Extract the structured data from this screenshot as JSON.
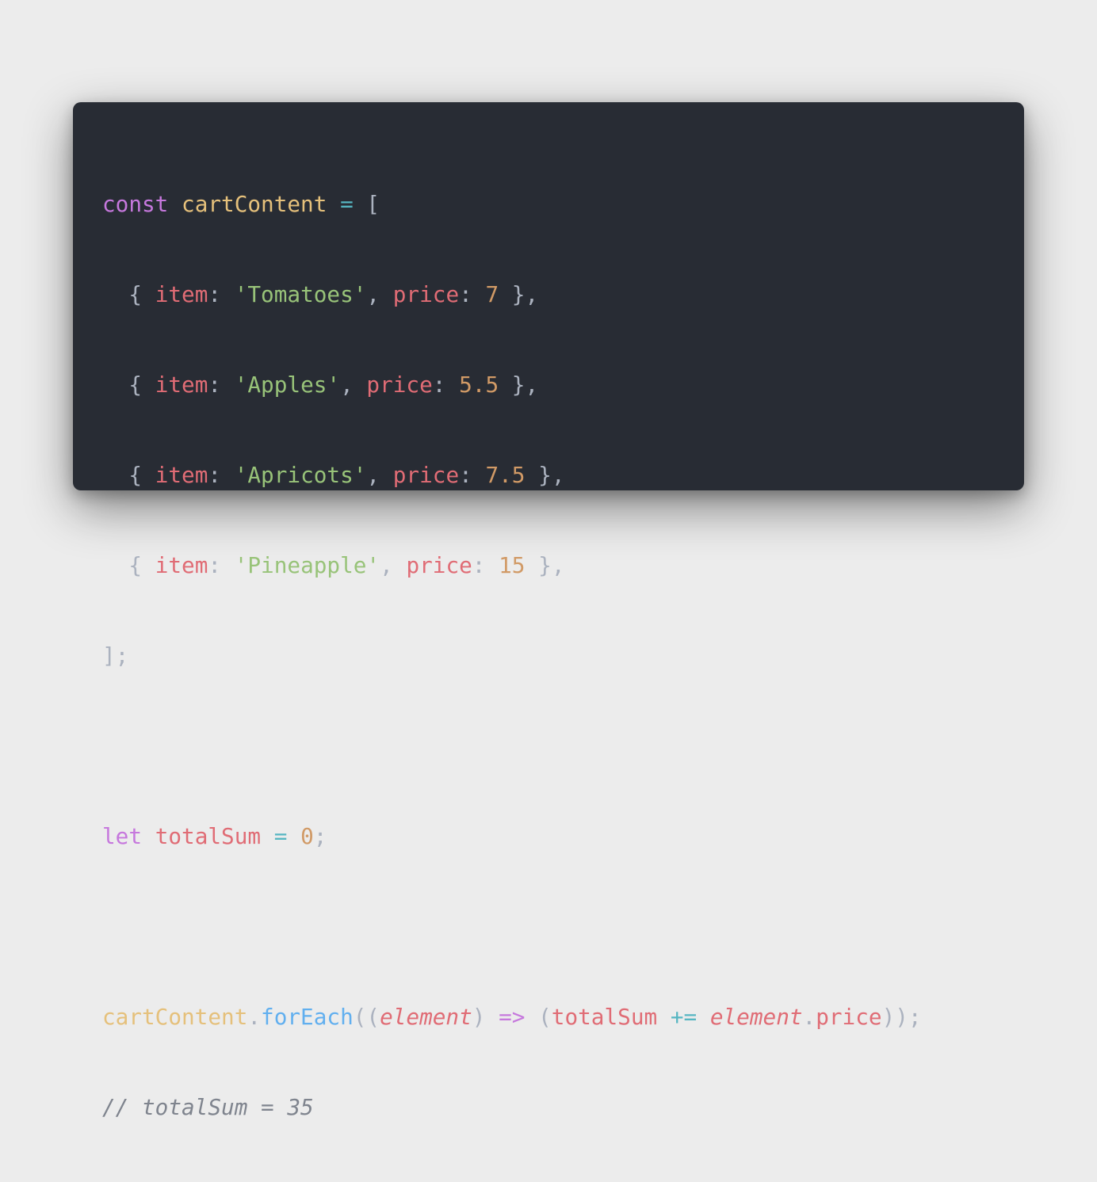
{
  "code": {
    "line1": {
      "kw": "const",
      "name": "cartContent",
      "op": "=",
      "open": "["
    },
    "items": [
      {
        "key1": "item",
        "str": "'Tomatoes'",
        "key2": "price",
        "num": "7"
      },
      {
        "key1": "item",
        "str": "'Apples'",
        "key2": "price",
        "num": "5.5"
      },
      {
        "key1": "item",
        "str": "'Apricots'",
        "key2": "price",
        "num": "7.5"
      },
      {
        "key1": "item",
        "str": "'Pineapple'",
        "key2": "price",
        "num": "15"
      }
    ],
    "close": "];",
    "line_let": {
      "kw": "let",
      "name": "totalSum",
      "op": "=",
      "num": "0",
      "end": ";"
    },
    "line_foreach": {
      "obj": "cartContent",
      "dot": ".",
      "method": "forEach",
      "open": "((",
      "param": "element",
      "close_paren": ")",
      "arrow": "=>",
      "open2": "(",
      "var": "totalSum",
      "op": "+=",
      "param2": "element",
      "dot2": ".",
      "prop": "price",
      "end": "));"
    },
    "comment": "// totalSum = 35"
  },
  "colors": {
    "background": "#ececec",
    "editor_bg": "#282c34",
    "keyword": "#c678dd",
    "operator": "#56b6c2",
    "function": "#61afef",
    "object": "#e5c07b",
    "property": "#e06c75",
    "string": "#98c379",
    "number": "#d19a66",
    "comment": "#7f848e"
  }
}
